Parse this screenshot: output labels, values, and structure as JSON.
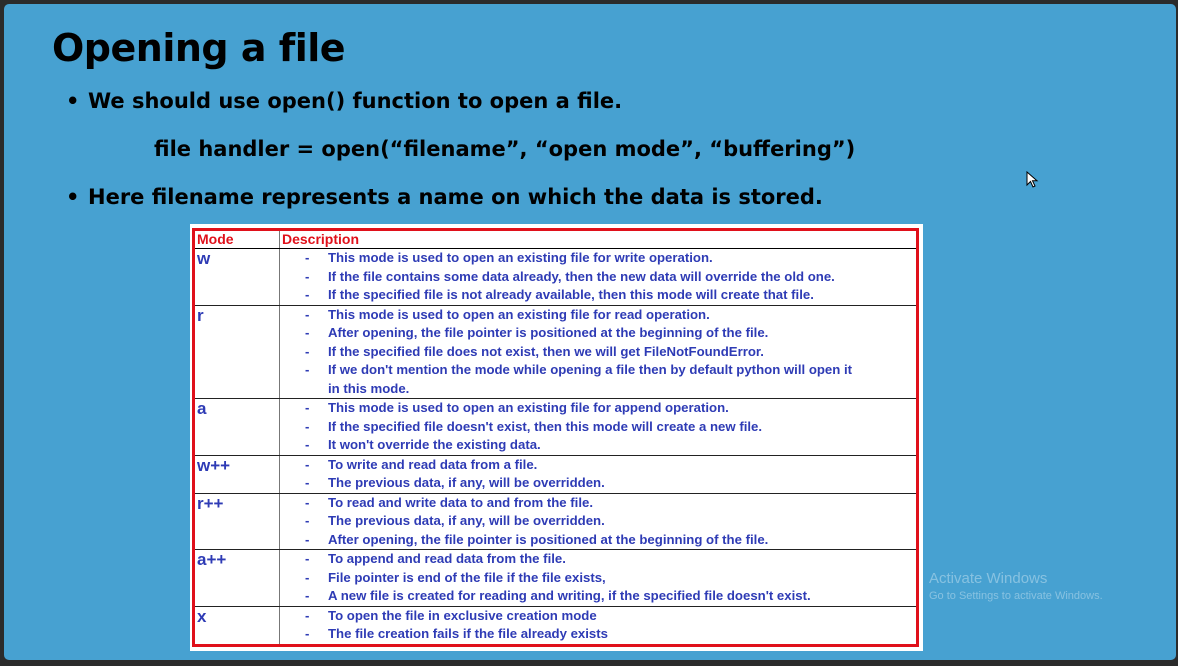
{
  "slide": {
    "title": "Opening a file",
    "bullet1": "We should use open() function to open a file.",
    "code_line": "file handler = open(“filename”, “open mode”, “buffering”)",
    "bullet2": "Here filename represents a name on which the data is stored."
  },
  "table": {
    "headers": {
      "mode": "Mode",
      "description": "Description"
    },
    "rows": [
      {
        "mode": "w",
        "items": [
          "This mode is used to open an existing file for write operation.",
          "If the file contains some data already, then the new data will override the old one.",
          "If the specified file is not already available, then this mode will create that file."
        ]
      },
      {
        "mode": "r",
        "items": [
          "This mode is used to open an existing file for read operation.",
          "After opening, the file pointer is positioned at the beginning of the file.",
          "If the specified file does not exist, then we will get FileNotFoundError.",
          "If we don't mention the mode while opening a file then by default python will open it"
        ],
        "continuation": "in this mode."
      },
      {
        "mode": "a",
        "items": [
          "This mode is used to open an existing file for append operation.",
          "If the specified file doesn't exist, then this mode will create a new file.",
          "It won't override the existing data."
        ]
      },
      {
        "mode": "w++",
        "items": [
          "To write and read data from a file.",
          "The previous data, if any, will be overridden."
        ]
      },
      {
        "mode": "r++",
        "items": [
          "To read and write data to and from the file.",
          "The previous data, if any, will be overridden.",
          "After opening, the file pointer is positioned at the beginning of the file."
        ]
      },
      {
        "mode": "a++",
        "items": [
          "To append and read data from the file.",
          "File pointer is end of the file if the file exists,",
          "A new file is created for reading and writing, if the specified file doesn't exist."
        ]
      },
      {
        "mode": "x",
        "items": [
          "To open the file in exclusive creation mode",
          "The file creation fails if the file already exists"
        ]
      }
    ]
  },
  "watermark": {
    "line1": "Activate Windows",
    "line2": "Go to Settings to activate Windows."
  },
  "colors": {
    "slide_background": "#47a1d1",
    "table_border": "#e0101a",
    "table_text": "#2e3bb5"
  },
  "icons": {
    "cursor": "mouse-pointer-icon"
  }
}
